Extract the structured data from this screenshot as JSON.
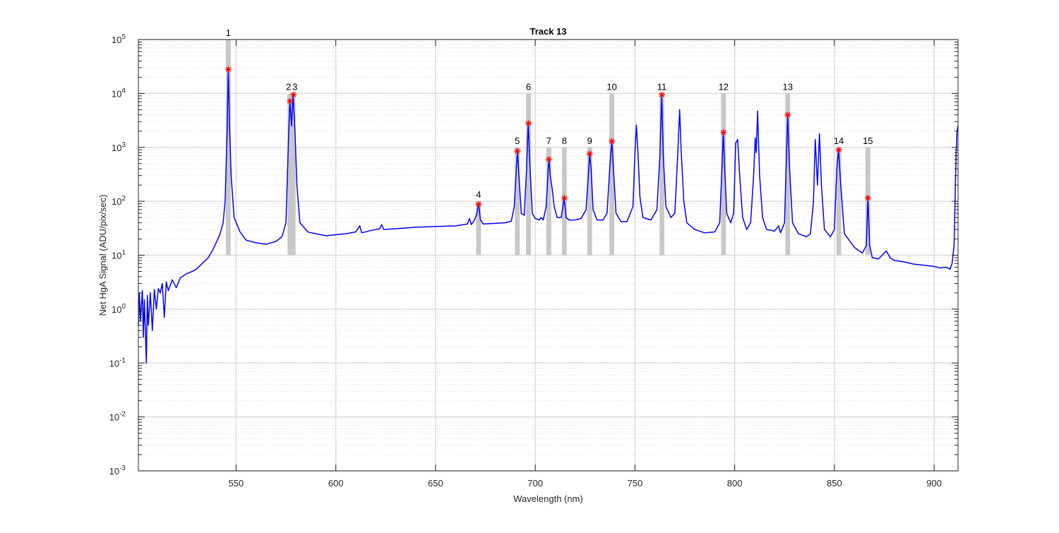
{
  "chart_data": {
    "type": "line",
    "title": "Track 13",
    "xlabel": "Wavelength (nm)",
    "ylabel": "Net HgA Signal (ADU/pix/sec)",
    "xlim": [
      501,
      912
    ],
    "ylim": [
      0.001,
      100000
    ],
    "yscale": "log",
    "grid": true,
    "minor_grid": true,
    "x_ticks": [
      550,
      600,
      650,
      700,
      750,
      800,
      850,
      900
    ],
    "x_tick_labels": [
      "550",
      "600",
      "650",
      "700",
      "750",
      "800",
      "850",
      "900"
    ],
    "y_tick_values": [
      0.001,
      0.01,
      0.1,
      1,
      10,
      100,
      1000,
      10000,
      100000
    ],
    "y_tick_exponents": [
      "-3",
      "-2",
      "-1",
      "0",
      "1",
      "2",
      "3",
      "4",
      "5"
    ],
    "y_tick_base": "10",
    "series": [
      {
        "color": "#0000ff",
        "points": [
          [
            501,
            0.5
          ],
          [
            501.5,
            2.0
          ],
          [
            502,
            0.6
          ],
          [
            503,
            2.2
          ],
          [
            503.5,
            0.3
          ],
          [
            504,
            1.5
          ],
          [
            505,
            0.1
          ],
          [
            505.5,
            1.8
          ],
          [
            506,
            0.5
          ],
          [
            507,
            2.0
          ],
          [
            508,
            0.4
          ],
          [
            509,
            2.3
          ],
          [
            510,
            1.0
          ],
          [
            511,
            2.4
          ],
          [
            512,
            2.0
          ],
          [
            513,
            3.0
          ],
          [
            514,
            0.7
          ],
          [
            515,
            3.2
          ],
          [
            516,
            2.2
          ],
          [
            518,
            3.5
          ],
          [
            520,
            2.5
          ],
          [
            522,
            3.8
          ],
          [
            525,
            4.5
          ],
          [
            528,
            5.0
          ],
          [
            530,
            5.5
          ],
          [
            533,
            7.0
          ],
          [
            536,
            9.0
          ],
          [
            538,
            12.0
          ],
          [
            540,
            17.0
          ],
          [
            542,
            25.0
          ],
          [
            543.5,
            40.0
          ],
          [
            544.5,
            100.0
          ],
          [
            545.5,
            2000.0
          ],
          [
            546.1,
            28000.0
          ],
          [
            546.8,
            2000.0
          ],
          [
            547.5,
            300.0
          ],
          [
            549,
            50.0
          ],
          [
            552,
            27.0
          ],
          [
            555,
            19.0
          ],
          [
            560,
            17.0
          ],
          [
            565,
            16.0
          ],
          [
            570,
            18.0
          ],
          [
            573,
            22.0
          ],
          [
            575,
            40.0
          ],
          [
            576.3,
            1500.0
          ],
          [
            577,
            7500.0
          ],
          [
            577.8,
            2500.0
          ],
          [
            578.6,
            9500.0
          ],
          [
            579.5,
            2000.0
          ],
          [
            580.5,
            200.0
          ],
          [
            582,
            40.0
          ],
          [
            586,
            27.0
          ],
          [
            590,
            25.0
          ],
          [
            595,
            23.0
          ],
          [
            600,
            24.0
          ],
          [
            605,
            25.0
          ],
          [
            610,
            27.0
          ],
          [
            612,
            35.0
          ],
          [
            613,
            26.0
          ],
          [
            618,
            29.0
          ],
          [
            622,
            31.0
          ],
          [
            623,
            37.0
          ],
          [
            624,
            30.0
          ],
          [
            630,
            31.0
          ],
          [
            640,
            33.0
          ],
          [
            650,
            34.0
          ],
          [
            660,
            35.0
          ],
          [
            666,
            38.0
          ],
          [
            667,
            48.0
          ],
          [
            668,
            37.0
          ],
          [
            669.5,
            45.0
          ],
          [
            670.5,
            55.0
          ],
          [
            671.6,
            88.0
          ],
          [
            672.5,
            45.0
          ],
          [
            674,
            38.0
          ],
          [
            680,
            39.0
          ],
          [
            685,
            40.0
          ],
          [
            688,
            43.0
          ],
          [
            689.5,
            80.0
          ],
          [
            690.5,
            400.0
          ],
          [
            691.1,
            850.0
          ],
          [
            691.8,
            300.0
          ],
          [
            693,
            60.0
          ],
          [
            694.5,
            55.0
          ],
          [
            695.5,
            300.0
          ],
          [
            696.5,
            2800.0
          ],
          [
            697.3,
            500.0
          ],
          [
            698.5,
            60.0
          ],
          [
            700,
            48.0
          ],
          [
            702,
            45.0
          ],
          [
            703,
            50.0
          ],
          [
            704,
            45.0
          ],
          [
            705.5,
            80.0
          ],
          [
            706.5,
            400.0
          ],
          [
            706.9,
            600.0
          ],
          [
            707.5,
            300.0
          ],
          [
            708.5,
            170.0
          ],
          [
            709.5,
            80.0
          ],
          [
            711,
            50.0
          ],
          [
            713,
            50.0
          ],
          [
            714.5,
            115.0
          ],
          [
            715.5,
            50.0
          ],
          [
            717,
            45.0
          ],
          [
            720,
            45.0
          ],
          [
            723,
            48.0
          ],
          [
            725.5,
            70.0
          ],
          [
            726.8,
            400.0
          ],
          [
            727.3,
            760.0
          ],
          [
            728,
            400.0
          ],
          [
            729,
            70.0
          ],
          [
            731,
            45.0
          ],
          [
            734,
            45.0
          ],
          [
            736,
            60.0
          ],
          [
            737.5,
            500.0
          ],
          [
            738.4,
            1300.0
          ],
          [
            739.2,
            400.0
          ],
          [
            740.5,
            60.0
          ],
          [
            743,
            42.0
          ],
          [
            746,
            42.0
          ],
          [
            749,
            80.0
          ],
          [
            750,
            800.0
          ],
          [
            750.7,
            2600.0
          ],
          [
            751.5,
            800.0
          ],
          [
            752.5,
            120.0
          ],
          [
            754,
            50.0
          ],
          [
            758,
            45.0
          ],
          [
            761,
            70.0
          ],
          [
            762.5,
            700.0
          ],
          [
            763.4,
            9500.0
          ],
          [
            764.2,
            700.0
          ],
          [
            765.5,
            80.0
          ],
          [
            768,
            50.0
          ],
          [
            770,
            60.0
          ],
          [
            771.5,
            800.0
          ],
          [
            772.4,
            5000.0
          ],
          [
            773.2,
            800.0
          ],
          [
            774.5,
            100.0
          ],
          [
            776,
            40.0
          ],
          [
            780,
            30.0
          ],
          [
            785,
            26.0
          ],
          [
            790,
            27.0
          ],
          [
            792.5,
            40.0
          ],
          [
            793.7,
            500.0
          ],
          [
            794.3,
            1900.0
          ],
          [
            795,
            400.0
          ],
          [
            796,
            60.0
          ],
          [
            798,
            40.0
          ],
          [
            799.5,
            60.0
          ],
          [
            800.5,
            1200.0
          ],
          [
            801.5,
            1400.0
          ],
          [
            802.5,
            300.0
          ],
          [
            804,
            50.0
          ],
          [
            806,
            30.0
          ],
          [
            808,
            40.0
          ],
          [
            809.5,
            300.0
          ],
          [
            810.3,
            1500.0
          ],
          [
            810.8,
            800.0
          ],
          [
            811.5,
            4700.0
          ],
          [
            812.5,
            300.0
          ],
          [
            814,
            50.0
          ],
          [
            816,
            30.0
          ],
          [
            820,
            28.0
          ],
          [
            822,
            35.0
          ],
          [
            823,
            26.0
          ],
          [
            825,
            40.0
          ],
          [
            826,
            800.0
          ],
          [
            826.6,
            4000.0
          ],
          [
            827.4,
            500.0
          ],
          [
            829,
            40.0
          ],
          [
            832,
            25.0
          ],
          [
            836,
            22.0
          ],
          [
            838,
            25.0
          ],
          [
            839.5,
            100.0
          ],
          [
            840.4,
            1400.0
          ],
          [
            841.5,
            200.0
          ],
          [
            842.5,
            1800.0
          ],
          [
            843.5,
            200.0
          ],
          [
            845,
            30.0
          ],
          [
            848,
            22.0
          ],
          [
            850,
            30.0
          ],
          [
            851.2,
            400.0
          ],
          [
            852.1,
            900.0
          ],
          [
            853.2,
            200.0
          ],
          [
            855,
            25.0
          ],
          [
            860,
            14.0
          ],
          [
            864,
            11.0
          ],
          [
            866,
            15.0
          ],
          [
            866.8,
            115.0
          ],
          [
            867.7,
            15.0
          ],
          [
            869,
            9.0
          ],
          [
            872,
            8.5
          ],
          [
            874,
            10.0
          ],
          [
            876,
            12.0
          ],
          [
            878,
            9.0
          ],
          [
            880,
            8.0
          ],
          [
            885,
            7.5
          ],
          [
            890,
            6.8
          ],
          [
            895,
            6.5
          ],
          [
            900,
            6.2
          ],
          [
            903,
            5.8
          ],
          [
            906,
            6.0
          ],
          [
            908,
            5.5
          ],
          [
            909,
            7.0
          ],
          [
            910,
            15.0
          ],
          [
            910.5,
            100.0
          ],
          [
            911,
            700.0
          ],
          [
            911.5,
            2000.0
          ],
          [
            912,
            2500.0
          ]
        ]
      }
    ],
    "peaks": [
      {
        "label": "1",
        "x": 546.1,
        "y": 28000
      },
      {
        "label": "2",
        "x": 577.0,
        "y": 7200
      },
      {
        "label": "3",
        "x": 578.8,
        "y": 9500
      },
      {
        "label": "4",
        "x": 671.6,
        "y": 88
      },
      {
        "label": "5",
        "x": 691.0,
        "y": 850
      },
      {
        "label": "6",
        "x": 696.6,
        "y": 2800
      },
      {
        "label": "7",
        "x": 706.8,
        "y": 600
      },
      {
        "label": "8",
        "x": 714.6,
        "y": 115
      },
      {
        "label": "9",
        "x": 727.3,
        "y": 760
      },
      {
        "label": "10",
        "x": 738.4,
        "y": 1300
      },
      {
        "label": "11",
        "x": 763.5,
        "y": 9500
      },
      {
        "label": "12",
        "x": 794.4,
        "y": 1900
      },
      {
        "label": "13",
        "x": 826.6,
        "y": 4000
      },
      {
        "label": "14",
        "x": 852.2,
        "y": 900
      },
      {
        "label": "15",
        "x": 866.8,
        "y": 115
      }
    ],
    "peak_bands": [
      {
        "x0": 544.9,
        "x1": 547.3,
        "ytop": 100000
      },
      {
        "x0": 575.8,
        "x1": 579.8,
        "ytop": 10000
      },
      {
        "x0": 670.4,
        "x1": 672.8,
        "ytop": 100
      },
      {
        "x0": 689.8,
        "x1": 692.2,
        "ytop": 1000
      },
      {
        "x0": 695.4,
        "x1": 697.8,
        "ytop": 10000
      },
      {
        "x0": 705.6,
        "x1": 708.0,
        "ytop": 1000
      },
      {
        "x0": 713.4,
        "x1": 715.8,
        "ytop": 1000
      },
      {
        "x0": 726.1,
        "x1": 728.5,
        "ytop": 1000
      },
      {
        "x0": 737.2,
        "x1": 739.6,
        "ytop": 10000
      },
      {
        "x0": 762.3,
        "x1": 764.7,
        "ytop": 10000
      },
      {
        "x0": 793.2,
        "x1": 795.6,
        "ytop": 10000
      },
      {
        "x0": 825.4,
        "x1": 827.8,
        "ytop": 10000
      },
      {
        "x0": 851.0,
        "x1": 853.4,
        "ytop": 1000
      },
      {
        "x0": 865.6,
        "x1": 868.0,
        "ytop": 1000
      }
    ],
    "band_color": "#c8c8c8",
    "marker_color": "#ff0000",
    "grid_color": "#dcdcdc"
  }
}
